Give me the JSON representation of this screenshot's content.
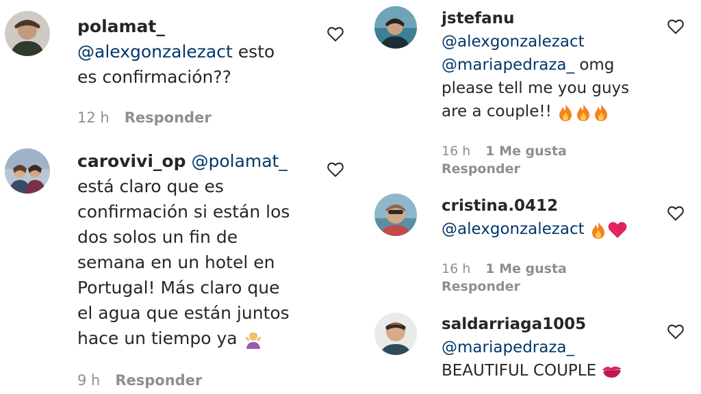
{
  "comments": [
    {
      "username": "polamat_",
      "mention": "@alexgonzalezact",
      "text_line1_rest": " esto",
      "text_line2": "es confirmación??",
      "time": "12 h",
      "reply_label": "Responder"
    },
    {
      "username": "carovivi_op",
      "mention": "@polamat_",
      "lines": [
        "está claro que es",
        "confirmación si están los",
        "dos solos un fin de",
        "semana en un hotel en",
        "Portugal! Más claro que",
        "el agua que están juntos",
        "hace un tiempo ya"
      ],
      "emoji_icon": "person-shrugging-icon",
      "time": "9 h",
      "reply_label": "Responder"
    },
    {
      "username": "jstefanu",
      "mentions": [
        "@alexgonzalezact",
        "@mariapedraza_"
      ],
      "text_after_mention": " omg",
      "lines": [
        "please tell me you guys",
        "are a couple!!"
      ],
      "emoji_icon": "fire-icon",
      "time": "16 h",
      "likes": "1 Me gusta",
      "reply_label": "Responder"
    },
    {
      "username": "cristina.0412",
      "mention": "@alexgonzalezact",
      "emoji_icons": [
        "fire-icon",
        "red-heart-icon"
      ],
      "time": "16 h",
      "likes": "1 Me gusta",
      "reply_label": "Responder"
    },
    {
      "username": "saldarriaga1005",
      "mention": "@mariapedraza_",
      "text": "BEAUTIFUL COUPLE",
      "emoji_icon": "kiss-mark-icon"
    }
  ],
  "colors": {
    "text": "#262626",
    "mention": "#00376b",
    "meta": "#8e8e8e",
    "fire": "#f58220",
    "heart_red": "#e0245e"
  }
}
